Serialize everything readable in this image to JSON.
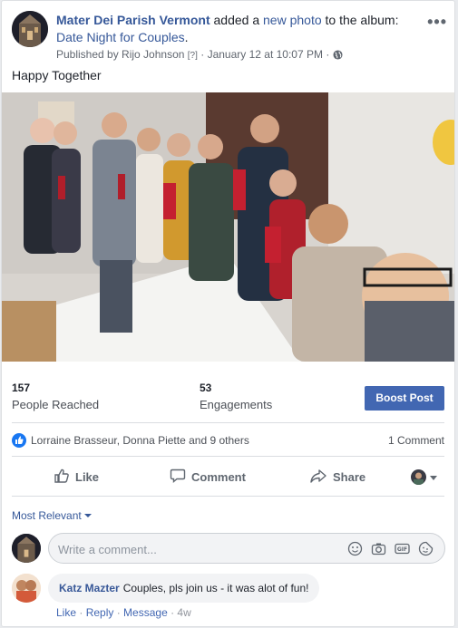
{
  "post": {
    "page_name": "Mater Dei Parish Vermont",
    "action_text": " added a ",
    "new_photo": "new photo",
    "to_album": " to the album: ",
    "album_name": "Date Night for Couples",
    "album_period": ".",
    "published_by_prefix": "Published by ",
    "publisher": "Rijo Johnson",
    "help_marker": "[?]",
    "sep": " · ",
    "timestamp": "January 12 at 10:07 PM",
    "audience_icon": "globe-icon",
    "menu_label": "•••",
    "caption": "Happy Together"
  },
  "stats": {
    "reached_value": "157",
    "reached_label": "People Reached",
    "engagements_value": "53",
    "engagements_label": "Engagements",
    "boost_label": "Boost Post"
  },
  "reactions": {
    "names": "Lorraine Brasseur, Donna Piette and 9 others",
    "comment_count": "1 Comment"
  },
  "actions": {
    "like": "Like",
    "comment": "Comment",
    "share": "Share"
  },
  "comments": {
    "sort_label": "Most Relevant",
    "placeholder": "Write a comment...",
    "items": [
      {
        "author": "Katz Mazter",
        "text": "Couples, pls join us - it was alot of fun!",
        "like": "Like",
        "reply": "Reply",
        "message": "Message",
        "dot": " · ",
        "age": "4w"
      }
    ]
  },
  "colors": {
    "link": "#365899",
    "boost_bg": "#4267b2",
    "like_badge": "#1877f2"
  }
}
